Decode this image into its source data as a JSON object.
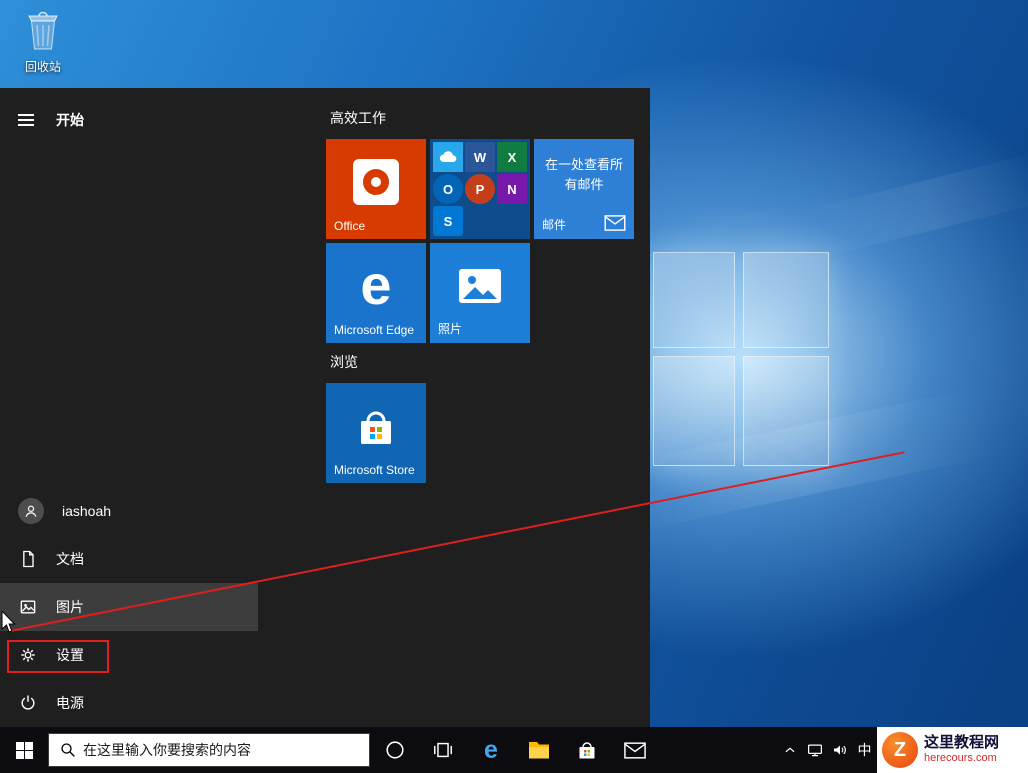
{
  "desktop": {
    "recycle_bin": "回收站"
  },
  "start": {
    "title": "开始",
    "user": "iashoah",
    "documents": "文档",
    "pictures": "图片",
    "settings": "设置",
    "power": "电源",
    "section_productivity": "高效工作",
    "section_explore": "浏览",
    "tiles": {
      "office": "Office",
      "mail_title": "在一处查看所有邮件",
      "mail": "邮件",
      "edge": "Microsoft Edge",
      "photos": "照片",
      "store": "Microsoft Store"
    },
    "mini": {
      "word": "W",
      "excel": "X",
      "outlook": "O",
      "powerpoint": "P",
      "onenote": "N",
      "skype": "S"
    }
  },
  "taskbar": {
    "search_placeholder": "在这里输入你要搜索的内容",
    "ime": "中"
  },
  "watermark": {
    "title": "这里教程网",
    "url": "herecours.com"
  },
  "icons": {
    "edge_glyph": "e",
    "watermark_glyph": "Z"
  },
  "colors": {
    "menu_bg": "#1F1F1F",
    "menu_highlight": "#3D3D3D",
    "taskbar_bg": "#0C0C10",
    "annotation": "#E01E1E",
    "office_tile": "#D83B01",
    "folder_tile": "#0E4C8C",
    "mail_tile": "#2E7FD6",
    "edge_tile": "#1B74CC",
    "photos_tile": "#1E7FD8",
    "store_tile": "#1166B3",
    "onedrive_blue": "#28A8EA",
    "word_blue": "#2B579A",
    "excel_green": "#107C41",
    "outlook_blue": "#0364B8",
    "ppt_orange": "#C43E1C",
    "onenote_purple": "#7719AA",
    "skype_blue": "#0078D4",
    "ms_red": "#F25022",
    "ms_green": "#7FBA00",
    "ms_blue": "#00A4EF",
    "ms_yellow": "#FFB900",
    "watermark_orange": "#E8430D",
    "watermark_orange_light": "#F98F2B",
    "watermark_navy": "#101038",
    "watermark_red": "#D42A2A"
  }
}
